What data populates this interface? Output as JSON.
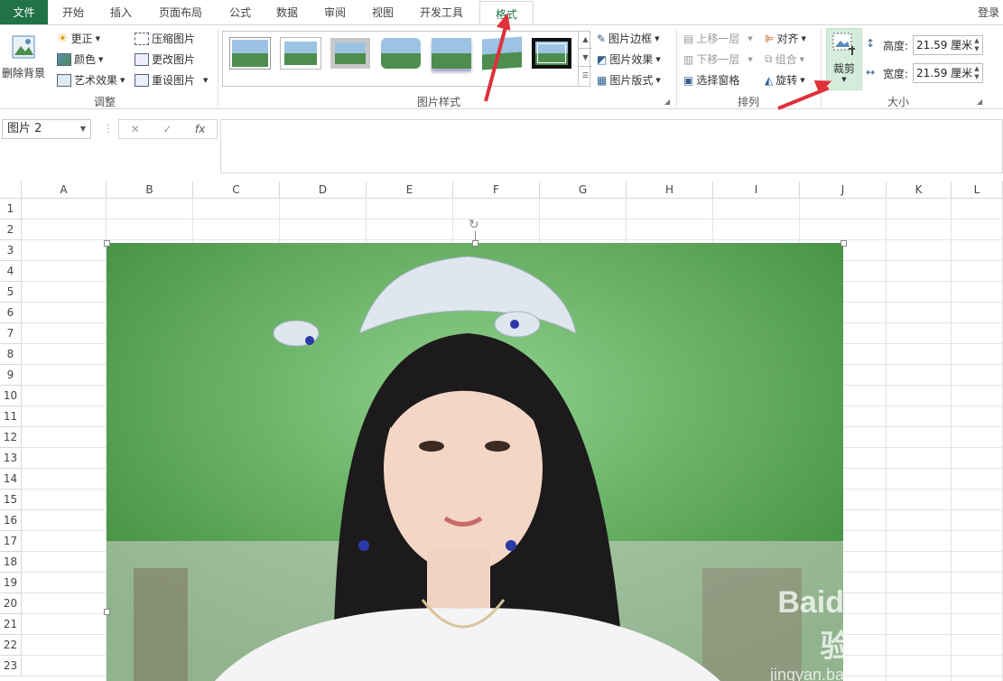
{
  "tabs": {
    "file": "文件",
    "items": [
      "开始",
      "插入",
      "页面布局",
      "公式",
      "数据",
      "审阅",
      "视图",
      "开发工具"
    ],
    "active": "格式",
    "login": "登录"
  },
  "ribbon": {
    "adjust": {
      "remove_bg": "删除背景",
      "corrections": "更正",
      "color": "颜色",
      "art_effects": "艺术效果",
      "compress": "压缩图片",
      "change": "更改图片",
      "reset": "重设图片",
      "label": "调整"
    },
    "styles": {
      "border": "图片边框",
      "effects": "图片效果",
      "layout": "图片版式",
      "label": "图片样式"
    },
    "arrange": {
      "bring_forward": "上移一层",
      "send_backward": "下移一层",
      "selection_pane": "选择窗格",
      "align": "对齐",
      "group": "组合",
      "rotate": "旋转",
      "label": "排列"
    },
    "size": {
      "crop": "裁剪",
      "height_label": "高度:",
      "height_value": "21.59 厘米",
      "width_label": "宽度:",
      "width_value": "21.59 厘米",
      "label": "大小"
    }
  },
  "formula_bar": {
    "name_box": "图片 2",
    "fx": "fx"
  },
  "sheet": {
    "columns": [
      "A",
      "B",
      "C",
      "D",
      "E",
      "F",
      "G",
      "H",
      "I",
      "J",
      "K",
      "L"
    ],
    "rows": [
      "1",
      "2",
      "3",
      "4",
      "5",
      "6",
      "7",
      "8",
      "9",
      "10",
      "11",
      "12",
      "13",
      "14",
      "15",
      "16",
      "17",
      "18",
      "19",
      "20",
      "21",
      "22",
      "23"
    ]
  },
  "watermark": {
    "brand": "Baidu经验",
    "url": "jingyan.baidu.com"
  },
  "colors": {
    "excel_green": "#217346",
    "arrow_red": "#e0303a",
    "crop_highlight": "#d4ecdb"
  }
}
